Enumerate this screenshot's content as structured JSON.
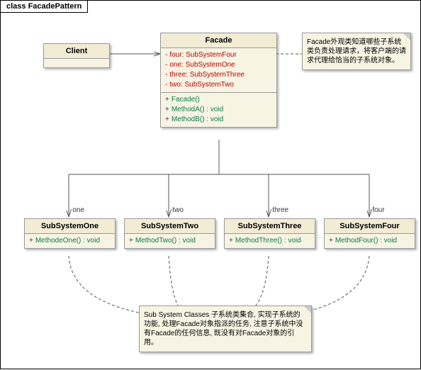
{
  "diagram_title": "class FacadePattern",
  "client": {
    "name": "Client"
  },
  "facade": {
    "name": "Facade",
    "attrs": [
      {
        "name": "four",
        "type": "SubSystemFour"
      },
      {
        "name": "one",
        "type": "SubSystemOne"
      },
      {
        "name": "three",
        "type": "SubSystemThree"
      },
      {
        "name": "two",
        "type": "SubSystemTwo"
      }
    ],
    "methods": [
      "Facade()",
      "MethodA() : void",
      "MethodB() : void"
    ]
  },
  "subs": [
    {
      "role": "-one",
      "name": "SubSystemOne",
      "method": "MethodeOne() : void"
    },
    {
      "role": "-two",
      "name": "SubSystemTwo",
      "method": "MethodTwo() : void"
    },
    {
      "role": "-three",
      "name": "SubSystemThree",
      "method": "MethodThree() : void"
    },
    {
      "role": "-four",
      "name": "SubSystemFour",
      "method": "MethodFour() : void"
    }
  ],
  "note1": "Facade外观类知道哪些子系统类负责处理请求，将客户端的请求代理给恰当的子系统对象。",
  "note2": "Sub System Classes 子系统类集合, 实现子系统的功能, 处理Facade对象指派的任务, 注意子系统中没有Facade的任何信息, 既没有对Facade对象的引用。"
}
